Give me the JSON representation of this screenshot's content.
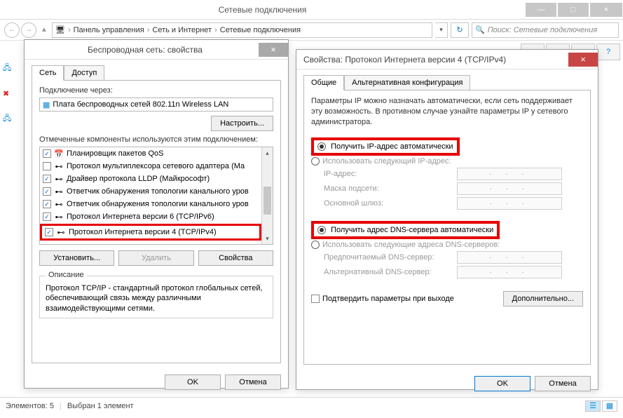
{
  "window": {
    "title": "Сетевые подключения",
    "min": "—",
    "max": "□",
    "close": "×"
  },
  "breadcrumb": {
    "back": "←",
    "fwd": "→",
    "up": "▲",
    "comp_icon": "🖥",
    "path1": "Панель управления",
    "path2": "Сеть и Интернет",
    "path3": "Сетевые подключения",
    "sep": "›",
    "refresh": "↻",
    "search_placeholder": "Поиск: Сетевые подключения",
    "search_icon": "🔍"
  },
  "status": {
    "count": "Элементов: 5",
    "selected": "Выбран 1 элемент"
  },
  "dialog_left": {
    "title": "Беспроводная сеть: свойства",
    "close": "×",
    "tab1": "Сеть",
    "tab2": "Доступ",
    "connect_label": "Подключение через:",
    "adapter": "Плата беспроводных сетей 802.11n Wireless LAN",
    "configure": "Настроить...",
    "components_label": "Отмеченные компоненты используются этим подключением:",
    "items": [
      {
        "chk": true,
        "icon": "📅",
        "label": "Планировщик пакетов QoS"
      },
      {
        "chk": false,
        "icon": "⊷",
        "label": "Протокол мультиплексора сетевого адаптера (Ма"
      },
      {
        "chk": true,
        "icon": "⊷",
        "label": "Драйвер протокола LLDP (Майкрософт)"
      },
      {
        "chk": true,
        "icon": "⊷",
        "label": "Ответчик обнаружения топологии канального уров"
      },
      {
        "chk": true,
        "icon": "⊷",
        "label": "Ответчик обнаружения топологии канального уров"
      },
      {
        "chk": true,
        "icon": "⊷",
        "label": "Протокол Интернета версии 6 (TCP/IPv6)"
      },
      {
        "chk": true,
        "icon": "⊷",
        "label": "Протокол Интернета версии 4 (TCP/IPv4)"
      }
    ],
    "install": "Установить...",
    "uninstall": "Удалить",
    "props": "Свойства",
    "desc_label": "Описание",
    "desc_text": "Протокол TCP/IP - стандартный протокол глобальных сетей, обеспечивающий связь между различными взаимодействующими сетями.",
    "ok": "OK",
    "cancel": "Отмена"
  },
  "dialog_right": {
    "title": "Свойства: Протокол Интернета версии 4 (TCP/IPv4)",
    "close": "×",
    "tab1": "Общие",
    "tab2": "Альтернативная конфигурация",
    "intro": "Параметры IP можно назначать автоматически, если сеть поддерживает эту возможность. В противном случае узнайте параметры IP у сетевого администратора.",
    "ip_auto": "Получить IP-адрес автоматически",
    "ip_manual": "Использовать следующий IP-адрес:",
    "ip_label": "IP-адрес:",
    "mask_label": "Маска подсети:",
    "gateway_label": "Основной шлюз:",
    "dns_auto": "Получить адрес DNS-сервера автоматически",
    "dns_manual": "Использовать следующие адреса DNS-серверов:",
    "dns1_label": "Предпочитаемый DNS-сервер:",
    "dns2_label": "Альтернативный DNS-сервер:",
    "confirm_exit": "Подтвердить параметры при выходе",
    "advanced": "Дополнительно...",
    "ok": "OK",
    "cancel": "Отмена",
    "dots": "..."
  }
}
